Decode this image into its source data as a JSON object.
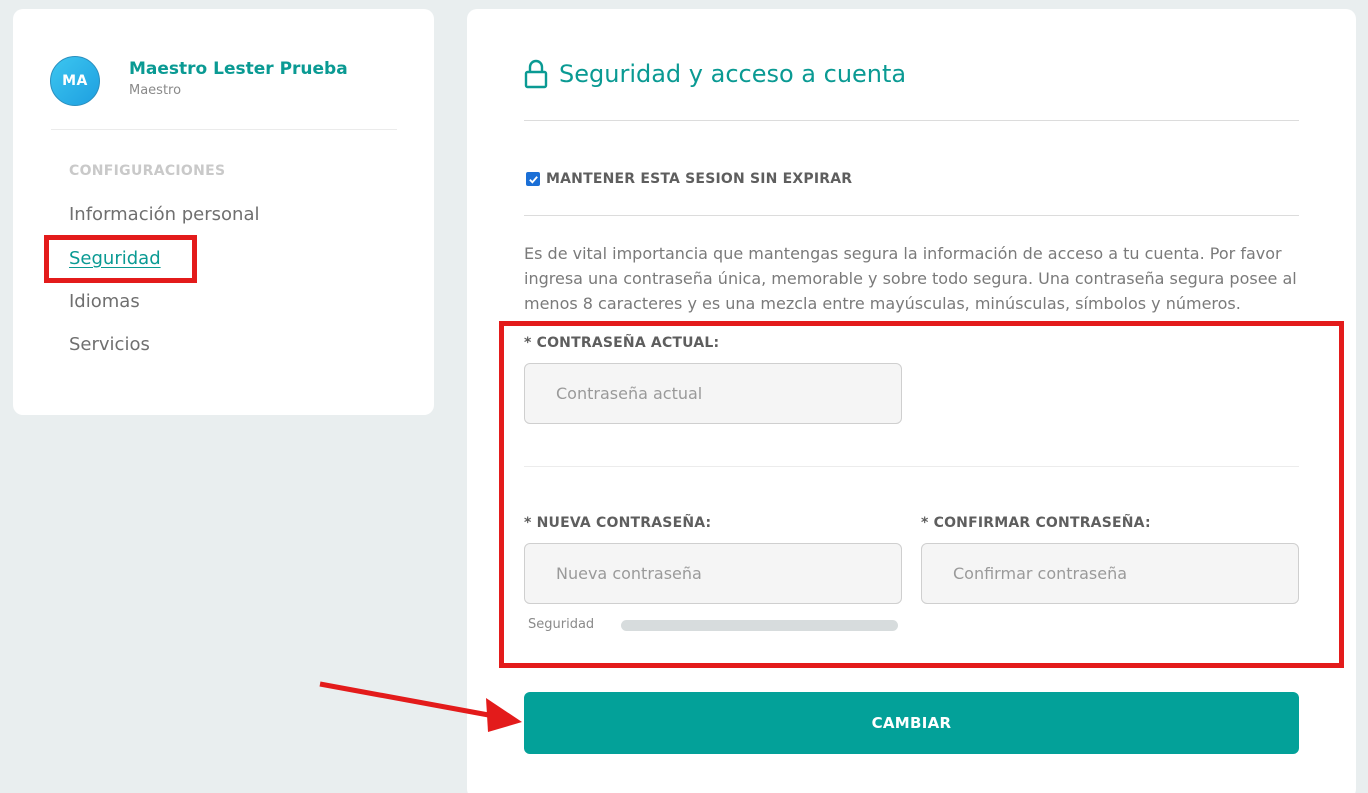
{
  "profile": {
    "initials": "MA",
    "name": "Maestro Lester Prueba",
    "role": "Maestro"
  },
  "sidebar": {
    "section_title": "CONFIGURACIONES",
    "items": [
      {
        "label": "Información personal",
        "active": false
      },
      {
        "label": "Seguridad",
        "active": true
      },
      {
        "label": "Idiomas",
        "active": false
      },
      {
        "label": "Servicios",
        "active": false
      }
    ]
  },
  "security": {
    "title": "Seguridad y acceso a cuenta",
    "title_icon": "lock-icon",
    "keep_session_label": "MANTENER ESTA SESION SIN EXPIRAR",
    "keep_session_checked": true,
    "info": "Es de vital importancia que mantengas segura la información de acceso a tu cuenta. Por favor ingresa una contraseña única, memorable y sobre todo segura. Una contraseña segura posee al menos 8 caracteres y es una mezcla entre mayúsculas, minúsculas, símbolos y números.",
    "current_password": {
      "label": "* CONTRASEÑA ACTUAL:",
      "placeholder": "Contraseña actual",
      "value": ""
    },
    "new_password": {
      "label": "* NUEVA CONTRASEÑA:",
      "placeholder": "Nueva contraseña",
      "value": ""
    },
    "confirm_password": {
      "label": "* CONFIRMAR CONTRASEÑA:",
      "placeholder": "Confirmar contraseña",
      "value": ""
    },
    "strength_label": "Seguridad",
    "strength_value": 0,
    "submit_label": "CAMBIAR"
  },
  "colors": {
    "accent": "#0a9a93",
    "button": "#03a199",
    "annotation": "#e31b1b",
    "background": "#e9eeef"
  }
}
